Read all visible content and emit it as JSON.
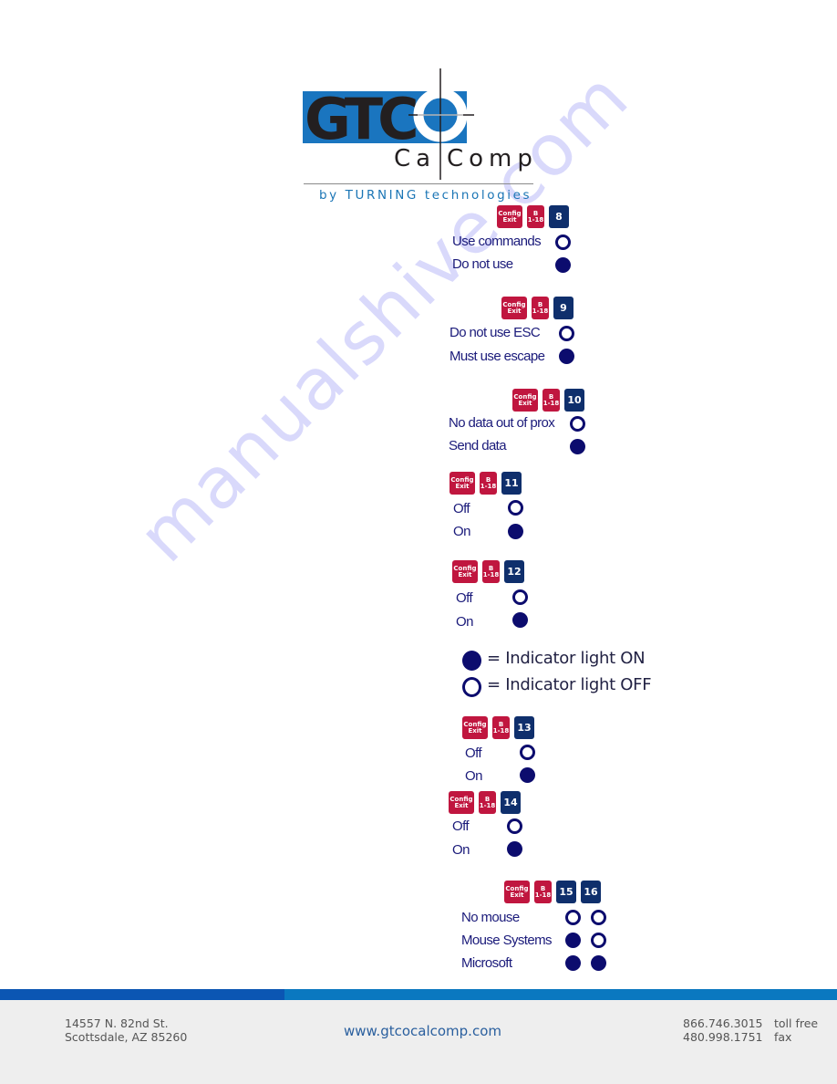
{
  "logo": {
    "brand_main": "GTCO",
    "brand_sub": "CalComp",
    "tagline": "by TURNING technologies",
    "colors": {
      "blue": "#1a75bf",
      "black": "#231f20",
      "tagline": "#1a75b5"
    }
  },
  "key_labels": {
    "config_line1": "Config",
    "config_line2": "Exit",
    "b_line1": "B",
    "b_line2": "1-18"
  },
  "sections": [
    {
      "switch": "8",
      "options": [
        {
          "label": "Use commands",
          "states": [
            "off"
          ]
        },
        {
          "label": "Do not use",
          "states": [
            "on"
          ]
        }
      ]
    },
    {
      "switch": "9",
      "options": [
        {
          "label": "Do not use ESC",
          "states": [
            "off"
          ]
        },
        {
          "label": "Must use escape",
          "states": [
            "on"
          ]
        }
      ]
    },
    {
      "switch": "10",
      "options": [
        {
          "label": "No data out of prox",
          "states": [
            "off"
          ]
        },
        {
          "label": "Send data",
          "states": [
            "on"
          ]
        }
      ]
    },
    {
      "switch": "11",
      "options": [
        {
          "label": "Off",
          "states": [
            "off"
          ]
        },
        {
          "label": "On",
          "states": [
            "on"
          ]
        }
      ]
    },
    {
      "switch": "12",
      "options": [
        {
          "label": "Off",
          "states": [
            "off"
          ]
        },
        {
          "label": "On",
          "states": [
            "on"
          ]
        }
      ]
    },
    {
      "switch": "13",
      "options": [
        {
          "label": "Off",
          "states": [
            "off"
          ]
        },
        {
          "label": "On",
          "states": [
            "on"
          ]
        }
      ]
    },
    {
      "switch": "14",
      "options": [
        {
          "label": "Off",
          "states": [
            "off"
          ]
        },
        {
          "label": "On",
          "states": [
            "on"
          ]
        }
      ]
    },
    {
      "switches": [
        "15",
        "16"
      ],
      "options": [
        {
          "label": "No mouse",
          "states": [
            "off",
            "off"
          ]
        },
        {
          "label": "Mouse Systems",
          "states": [
            "on",
            "off"
          ]
        },
        {
          "label": "Microsoft",
          "states": [
            "on",
            "on"
          ]
        }
      ]
    }
  ],
  "legend": {
    "on_text": "= Indicator light ON",
    "off_text": "= Indicator light OFF"
  },
  "watermark": "manualshive.com",
  "footer": {
    "address_line1": "14557 N. 82nd St.",
    "address_line2": "Scottsdale, AZ 85260",
    "url": "www.gtcocalcomp.com",
    "phone1": "866.746.3015",
    "phone1_label": "toll free",
    "phone2": "480.998.1751",
    "phone2_label": "fax"
  },
  "colors": {
    "key_red": "#c0163f",
    "key_navy": "#0f2f6c",
    "indicator": "#0c0c6e",
    "option_text": "#1a1a7a",
    "footer_band_dark": "#0b56b3",
    "footer_band_light": "#0a78c0",
    "footer_bg": "#eeeeee"
  }
}
